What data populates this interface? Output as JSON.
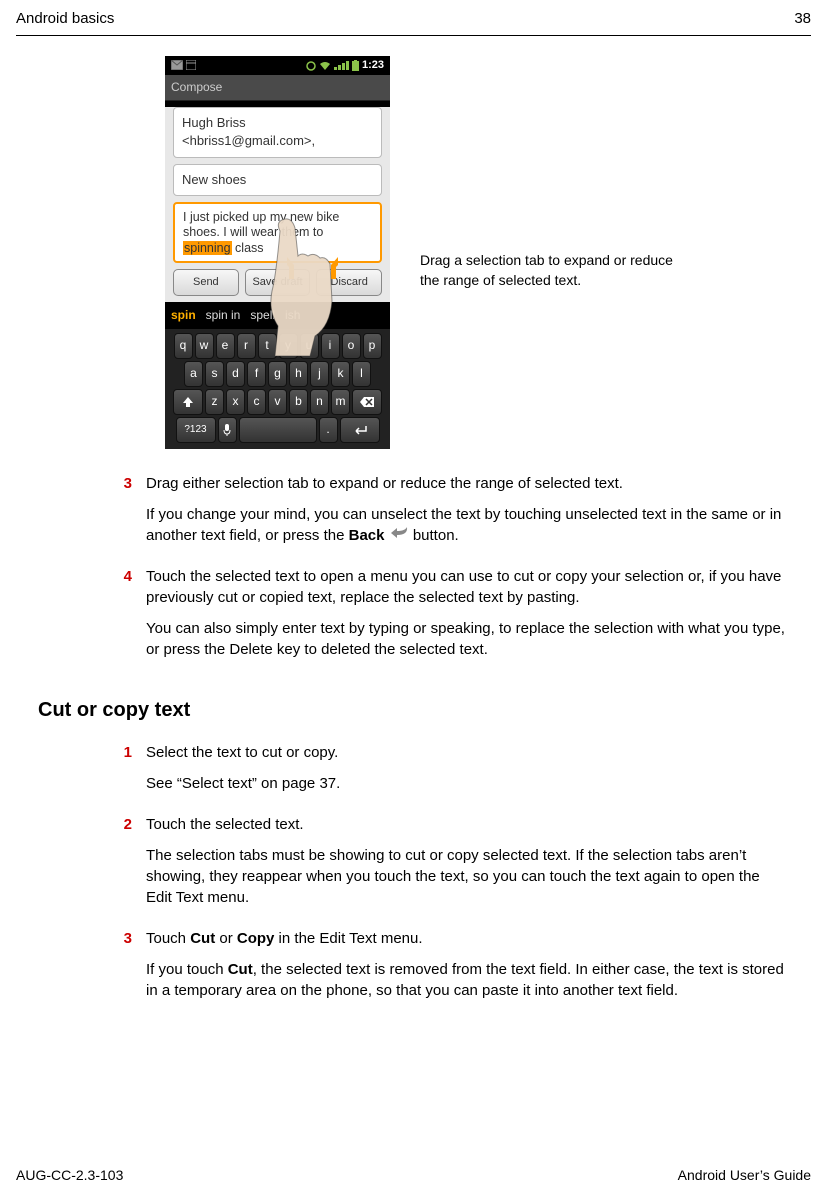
{
  "header": {
    "left": "Android basics",
    "right": "38"
  },
  "phone": {
    "time": "1:23",
    "compose_label": "Compose",
    "to_field": "Hugh Briss <hbriss1@gmail.com>,",
    "subject_field": "New shoes",
    "msg_before": "I just picked up my new bike shoes. I will wear them to ",
    "msg_highlight": "spinning",
    "msg_after": " class",
    "btn_send": "Send",
    "btn_save": "Save draft",
    "btn_discard": "Discard",
    "suggest": [
      "spin",
      "spin in",
      "spell",
      "ish"
    ],
    "row1": [
      "q",
      "w",
      "e",
      "r",
      "t",
      "y",
      "u",
      "i",
      "o",
      "p"
    ],
    "row2": [
      "a",
      "s",
      "d",
      "f",
      "g",
      "h",
      "j",
      "k",
      "l"
    ],
    "row3_mid": [
      "z",
      "x",
      "c",
      "v",
      "b",
      "n",
      "m"
    ],
    "sym_key": "?123"
  },
  "caption": "Drag a selection tab to expand or reduce the range of selected text.",
  "steps_a": {
    "s3_num": "3",
    "s3_p1": "Drag either selection tab to expand or reduce the range of selected text.",
    "s3_p2a": "If you change your mind, you can unselect the text by touching unselected text in the same or in another text field, or press the ",
    "s3_back": "Back",
    "s3_p2b": " button.",
    "s4_num": "4",
    "s4_p1": "Touch the selected text to open a menu you can use to cut or copy your selection or, if you have previously cut or copied text, replace the selected text by pasting.",
    "s4_p2": "You can also simply enter text by typing or speaking, to replace the selection with what you type, or press the Delete key to deleted the selected text."
  },
  "section_title": "Cut or copy text",
  "steps_b": {
    "s1_num": "1",
    "s1_p1": "Select the text to cut or copy.",
    "s1_p2": "See “Select text” on page 37.",
    "s2_num": "2",
    "s2_p1": "Touch the selected text.",
    "s2_p2": "The selection tabs must be showing to cut or copy selected text. If the selection tabs aren’t showing, they reappear when you touch the text, so you can touch the text again to open the Edit Text menu.",
    "s3_num": "3",
    "s3_p1a": "Touch ",
    "s3_cut": "Cut",
    "s3_or": " or ",
    "s3_copy": "Copy",
    "s3_p1b": " in the Edit Text menu.",
    "s3_p2a": "If you touch ",
    "s3_cut2": "Cut",
    "s3_p2b": ", the selected text is removed from the text field. In either case, the text is stored in a temporary area on the phone, so that you can paste it into another text field."
  },
  "footer": {
    "left": "AUG-CC-2.3-103",
    "right": "Android User’s Guide"
  }
}
